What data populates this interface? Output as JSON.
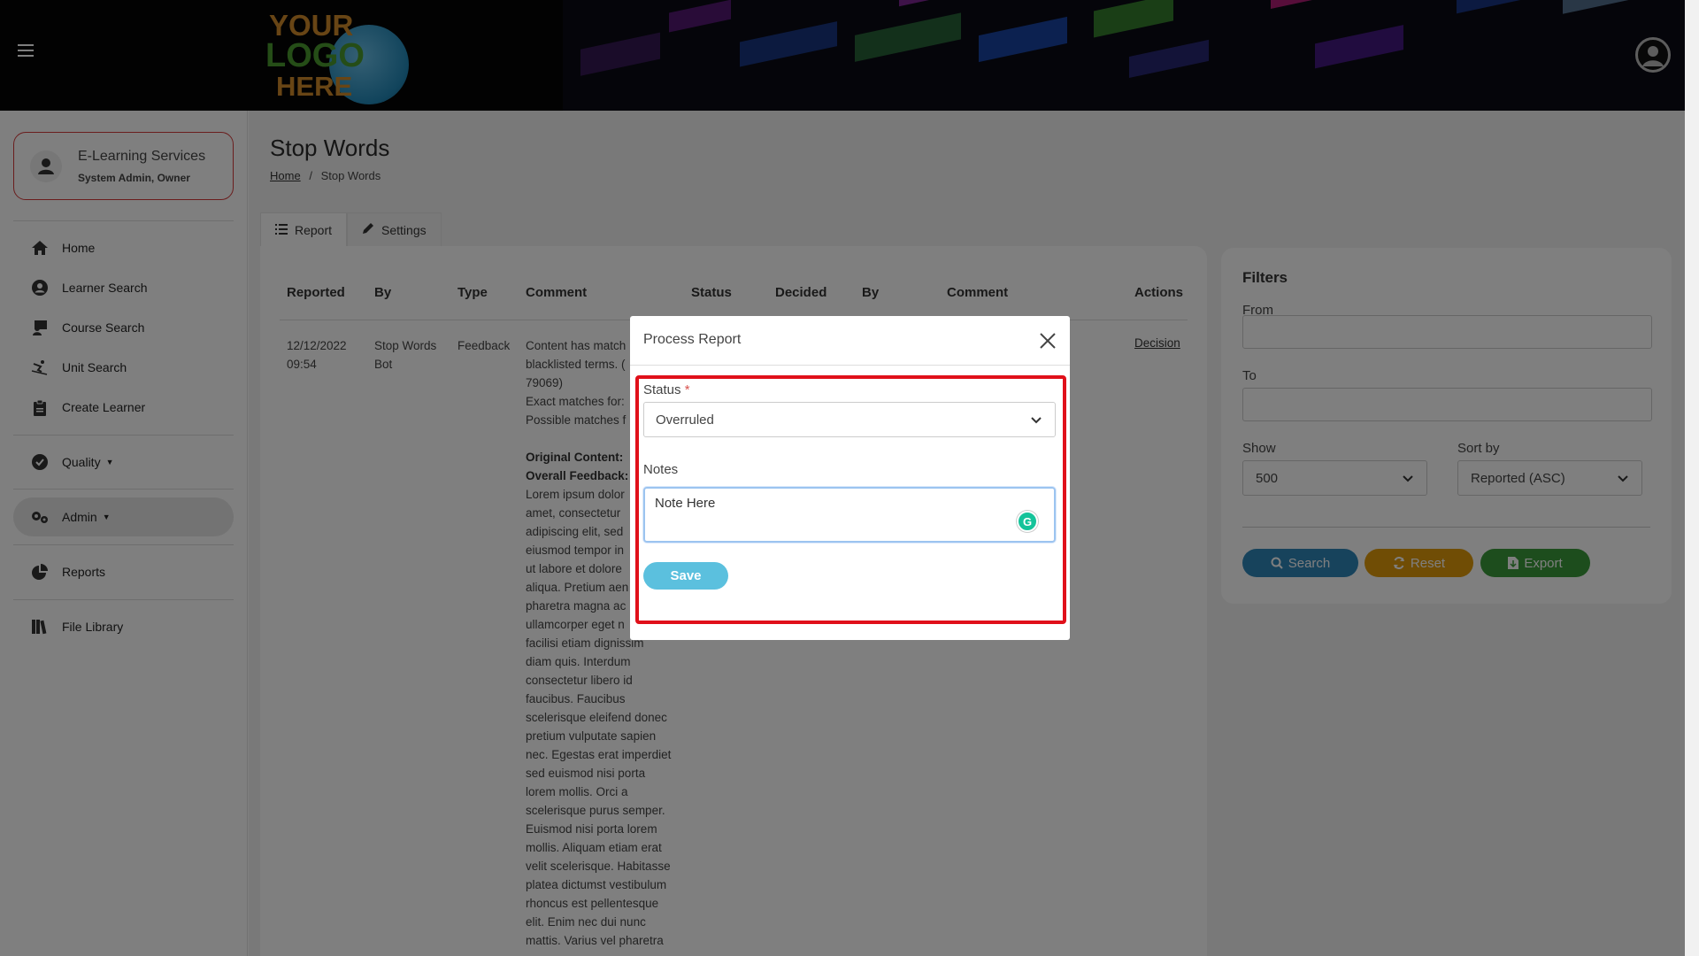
{
  "header": {
    "logo_lines": [
      "YOUR",
      "LOGO",
      "HERE"
    ],
    "menu_icon": "hamburger-icon",
    "account_icon": "user-circle-icon"
  },
  "sidebar": {
    "user": {
      "name": "E-Learning Services",
      "role": "System Admin, Owner",
      "icon": "user-icon"
    },
    "items": [
      {
        "label": "Home",
        "icon": "home-icon"
      },
      {
        "label": "Learner Search",
        "icon": "user-circle-icon"
      },
      {
        "label": "Course Search",
        "icon": "teacher-icon"
      },
      {
        "label": "Unit Search",
        "icon": "skier-icon"
      },
      {
        "label": "Create Learner",
        "icon": "clipboard-icon"
      },
      {
        "label": "Quality",
        "icon": "check-circle-icon"
      },
      {
        "label": "Admin",
        "icon": "cogs-icon"
      },
      {
        "label": "Reports",
        "icon": "pie-chart-icon"
      },
      {
        "label": "File Library",
        "icon": "books-icon"
      }
    ]
  },
  "page": {
    "title": "Stop Words",
    "breadcrumb": {
      "home": "Home",
      "separator": "/",
      "current": "Stop Words"
    },
    "tabs": [
      {
        "label": "Report",
        "icon": "list-icon"
      },
      {
        "label": "Settings",
        "icon": "pencil-icon"
      }
    ]
  },
  "table": {
    "headers": [
      "Reported",
      "By",
      "Type",
      "Comment",
      "Status",
      "Decided",
      "By",
      "Comment",
      "Actions"
    ],
    "row": {
      "reported_date": "12/12/2022",
      "reported_time": "09:54",
      "by_1": "Stop Words",
      "by_2": "Bot",
      "type": "Feedback",
      "comment_lines": [
        "Content has match",
        "blacklisted terms. (",
        "79069)",
        "Exact matches for:",
        "Possible matches f"
      ],
      "original_content_label": "Original Content:",
      "overall_feedback_label": "Overall Feedback:",
      "feedback_lines": [
        "Lorem ipsum dolor",
        "amet, consectetur",
        "adipiscing elit, sed",
        "eiusmod tempor in",
        "ut labore et dolore",
        "aliqua. Pretium aen",
        "pharetra magna ac",
        "ullamcorper eget n",
        "facilisi etiam dignissim",
        "diam quis. Interdum",
        "consectetur libero id",
        "faucibus. Faucibus",
        "scelerisque eleifend donec",
        "pretium vulputate sapien",
        "nec. Egestas erat imperdiet",
        "sed euismod nisi porta",
        "lorem mollis. Orci a",
        "scelerisque purus semper.",
        "Euismod nisi porta lorem",
        "mollis. Aliquam etiam erat",
        "velit scelerisque. Habitasse",
        "platea dictumst vestibulum",
        "rhoncus est pellentesque",
        "elit. Enim nec dui nunc",
        "mattis. Varius vel pharetra"
      ],
      "action": "Decision"
    }
  },
  "filters": {
    "title": "Filters",
    "from_label": "From",
    "to_label": "To",
    "show_label": "Show",
    "show_value": "500",
    "sort_label": "Sort by",
    "sort_value": "Reported (ASC)",
    "search_btn": "Search",
    "reset_btn": "Reset",
    "export_btn": "Export",
    "colors": {
      "search": "#2f86b8",
      "reset": "#e09a0a",
      "export": "#3a9a3a"
    }
  },
  "modal": {
    "title": "Process Report",
    "status_label": "Status",
    "required_mark": "*",
    "status_value": "Overruled",
    "notes_label": "Notes",
    "notes_value": "Note Here",
    "grammarly_glyph": "G",
    "save_label": "Save"
  }
}
